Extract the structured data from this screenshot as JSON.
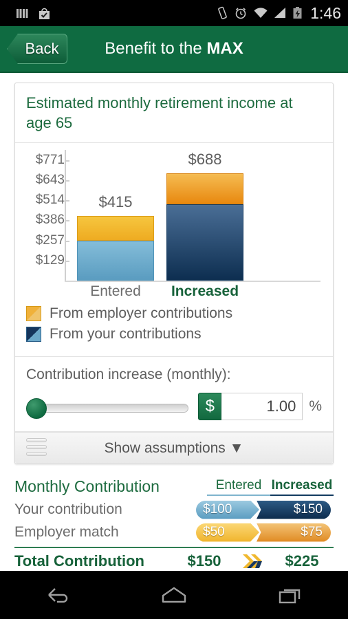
{
  "status_bar": {
    "icons_left": [
      "equalizer-bars-icon",
      "play-store-bag-icon"
    ],
    "icons_right": [
      "vibrate-icon",
      "alarm-clock-icon",
      "wifi-icon",
      "signal-bars-icon",
      "battery-charging-icon"
    ],
    "time": "1:46"
  },
  "action_bar": {
    "back_label": "Back",
    "title_normal": "Benefit to the ",
    "title_bold": "MAX",
    "background_color": "#0f6b41"
  },
  "card": {
    "title": "Estimated monthly retirement income at age 65"
  },
  "chart_data": {
    "type": "bar",
    "title": "Estimated monthly retirement income at age 65",
    "xlabel": "",
    "ylabel": "",
    "stacked": true,
    "categories": [
      "Entered",
      "Increased"
    ],
    "category_styles": [
      "normal",
      "highlighted"
    ],
    "series": [
      {
        "name": "From your contributions",
        "values": [
          257,
          487
        ],
        "color": "#5a9cc0",
        "color_highlight": "#0d2e50"
      },
      {
        "name": "From employer contributions",
        "values": [
          158,
          201
        ],
        "color": "#eeab21",
        "color_highlight": "#e8880f"
      }
    ],
    "totals": [
      415,
      688
    ],
    "total_labels": [
      "$415",
      "$688"
    ],
    "ytick_labels": [
      "$129",
      "$257",
      "$386",
      "$514",
      "$643",
      "$771"
    ],
    "ytick_values": [
      129,
      257,
      386,
      514,
      643,
      771
    ],
    "ylim": [
      0,
      836
    ],
    "grid": false,
    "legend_position": "below"
  },
  "legend": [
    {
      "label": "From employer contributions",
      "swatch": "employer-swatch"
    },
    {
      "label": "From your contributions",
      "swatch": "your-swatch"
    }
  ],
  "slider": {
    "caption": "Contribution increase (monthly):",
    "value_position_percent": 0,
    "currency_toggle": "$",
    "input_value": "1.00",
    "unit_suffix": "%"
  },
  "assumptions": {
    "label": "Show assumptions",
    "chevron": "▼"
  },
  "summary": {
    "header": {
      "title": "Monthly Contribution",
      "col_entered": "Entered",
      "col_increased": "Increased"
    },
    "rows": [
      {
        "name": "Your contribution",
        "entered": "$100",
        "increased": "$150",
        "style": "you"
      },
      {
        "name": "Employer match",
        "entered": "$50",
        "increased": "$75",
        "style": "employer"
      }
    ],
    "total": {
      "label": "Total Contribution",
      "entered": "$150",
      "increased": "$225",
      "chevron_icon": "double-chevron-right-icon"
    }
  },
  "nav_bar": {
    "back": "nav-back-icon",
    "home": "nav-home-icon",
    "recents": "nav-recents-icon"
  }
}
